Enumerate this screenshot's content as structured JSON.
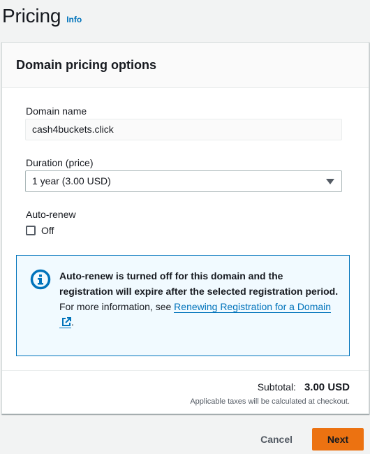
{
  "page": {
    "title": "Pricing",
    "info_link": "Info"
  },
  "card": {
    "title": "Domain pricing options",
    "domain_name": {
      "label": "Domain name",
      "value": "cash4buckets.click"
    },
    "duration": {
      "label": "Duration (price)",
      "selected": "1 year (3.00 USD)"
    },
    "auto_renew": {
      "label": "Auto-renew",
      "checkbox_label": "Off",
      "checked": false
    },
    "alert": {
      "strong_text": "Auto-renew is turned off for this domain and the registration will expire after the selected registration period.",
      "text_prefix": "For more information, see ",
      "link_text": "Renewing Registration for a Domain",
      "text_suffix": ".",
      "icon": "info-circle-icon"
    },
    "footer": {
      "subtotal_label": "Subtotal:",
      "subtotal_value": "3.00 USD",
      "tax_note": "Applicable taxes will be calculated at checkout."
    }
  },
  "actions": {
    "cancel_label": "Cancel",
    "next_label": "Next"
  },
  "colors": {
    "accent": "#0073bb",
    "primary_button": "#ec7211",
    "alert_bg": "#f1faff"
  }
}
